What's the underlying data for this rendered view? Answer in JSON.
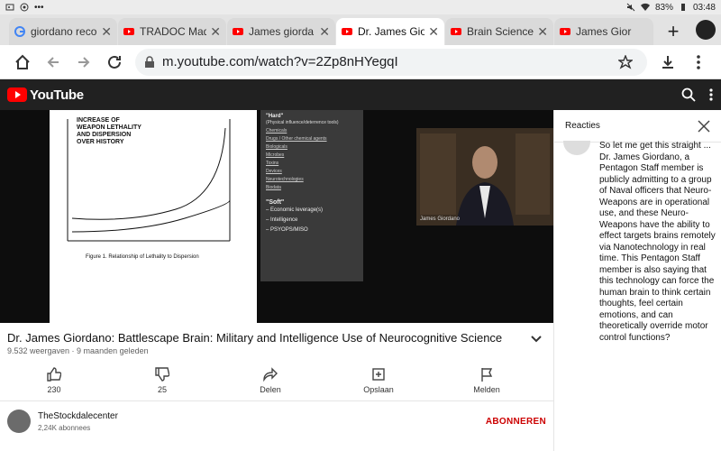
{
  "status_bar": {
    "battery": "83%",
    "time": "03:48",
    "dots": "•••"
  },
  "tabs": [
    {
      "title": "giordano reco",
      "favicon": "google-icon",
      "active": false
    },
    {
      "title": "TRADOC Mad",
      "favicon": "youtube-icon",
      "active": false
    },
    {
      "title": "James giorda",
      "favicon": "youtube-icon",
      "active": false
    },
    {
      "title": "Dr. James Gio",
      "favicon": "youtube-icon",
      "active": true
    },
    {
      "title": "Brain Science",
      "favicon": "youtube-icon",
      "active": false
    },
    {
      "title": "James Gior",
      "favicon": "youtube-icon",
      "active": false
    }
  ],
  "browser": {
    "url": "m.youtube.com/watch?v=2Zp8nHYegqI"
  },
  "youtube": {
    "brand": "YouTube"
  },
  "video": {
    "slide_left_title": "INCREASE OF WEAPON LETHALITY AND DISPERSION OVER HISTORY",
    "slide_left_figure": "Figure 1. Relationship of Lethality to Dispersion",
    "slide_right": {
      "hard_title": "\"Hard\"",
      "hard_sub": "(Physical influence/deterrence tools)",
      "hard_items": [
        "Chemicals",
        "Drugs / Other chemical agents",
        "Biologicals",
        "Microbes",
        "Toxins",
        "Devices",
        "Neurotechnologies",
        "Biodata"
      ],
      "soft_title": "\"Soft\"",
      "soft_items": [
        "Economic leverage(s)",
        "Intelligence",
        "PSYOPS/MISO"
      ]
    },
    "webcam_name": "James Giordano"
  },
  "info": {
    "title": "Dr. James Giordano: Battlescape Brain: Military and Intelligence Use of Neurocognitive Science",
    "meta": "9.532 weergaven · 9 maanden geleden",
    "actions": [
      {
        "label": "230",
        "icon": "thumbs-up-icon"
      },
      {
        "label": "25",
        "icon": "thumbs-down-icon"
      },
      {
        "label": "Delen",
        "icon": "share-icon"
      },
      {
        "label": "Opslaan",
        "icon": "add-to-playlist-icon"
      },
      {
        "label": "Melden",
        "icon": "flag-icon"
      }
    ],
    "channel": {
      "name": "TheStockdalecenter",
      "subscribers": "2,24K abonnees",
      "subscribe_label": "ABONNEREN"
    }
  },
  "comments": {
    "header": "Reacties",
    "body": "So let me get this straight ... Dr. James Giordano, a Pentagon Staff member is publicly admitting to a group of Naval officers that Neuro-Weapons are in operational use, and these Neuro-Weapons have the ability to effect targets brains remotely via Nanotechnology in real time. This Pentagon Staff member is also saying that this technology can force the human brain to think certain thoughts, feel certain emotions, and can theoretically override motor control functions?"
  },
  "colors": {
    "yt_header": "#212121",
    "subscribe": "#cc0000",
    "yt_red": "#ff0000"
  }
}
